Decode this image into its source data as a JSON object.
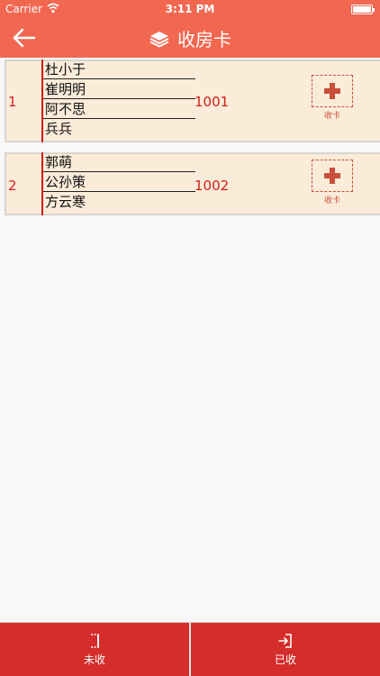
{
  "status_bar": {
    "carrier": "Carrier",
    "time": "3:11 PM",
    "battery_level": 1.0
  },
  "nav": {
    "title": "收房卡",
    "back_icon": "arrow-left-icon",
    "title_icon": "book-stack-icon"
  },
  "colors": {
    "accent": "#f26750",
    "row_bg": "#fbebd9",
    "red": "#d0201c",
    "tab_bg": "#d52d2b"
  },
  "rooms": [
    {
      "index": "1",
      "names": [
        "杜小于",
        "崔明明",
        "阿不思",
        "兵兵"
      ],
      "room_number": "1001",
      "action_label": "收卡"
    },
    {
      "index": "2",
      "names": [
        "郭萌",
        "公孙策",
        "方云寒"
      ],
      "room_number": "1002",
      "action_label": "收卡"
    }
  ],
  "tabs": [
    {
      "label": "未收",
      "icon": "card-outline-icon"
    },
    {
      "label": "已收",
      "icon": "card-enter-icon"
    }
  ]
}
